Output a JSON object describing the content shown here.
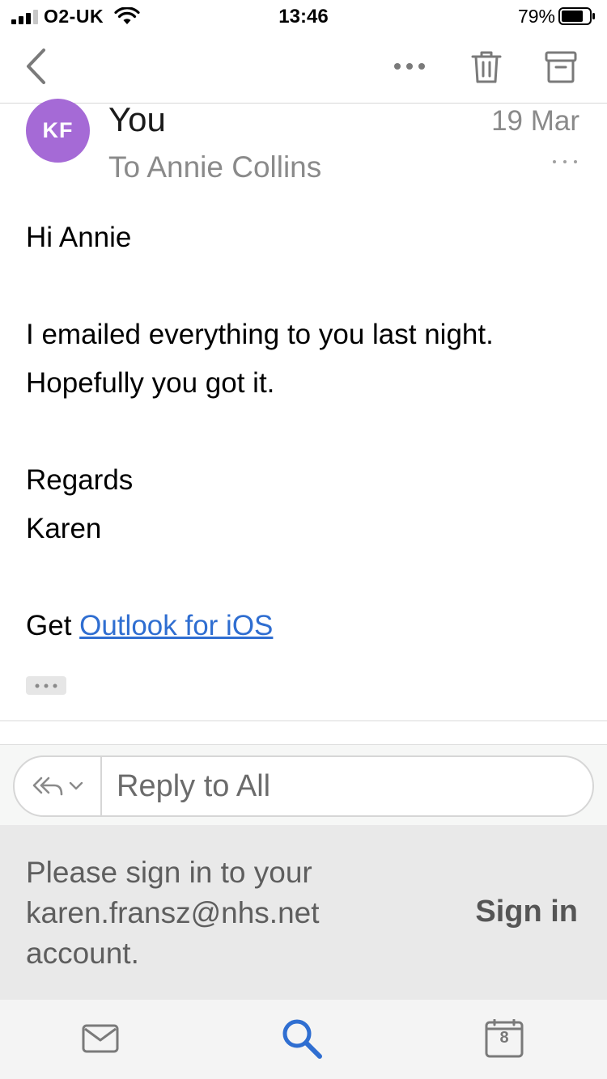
{
  "status_bar": {
    "carrier": "O2-UK",
    "time": "13:46",
    "battery_percent": "79%",
    "battery_level": 0.79,
    "signal_bars": 3,
    "signal_bars_max": 4
  },
  "toolbar": {
    "back_icon": "chevron-left-icon",
    "more_icon": "ellipsis-icon",
    "delete_icon": "trash-icon",
    "archive_icon": "archive-icon"
  },
  "message": {
    "avatar_initials": "KF",
    "avatar_color": "#a56ad6",
    "sender": "You",
    "recipient": "To Annie Collins",
    "date": "19 Mar",
    "body": {
      "greeting": "Hi Annie",
      "line1": "I emailed everything to you last night.",
      "line2": "Hopefully you got it.",
      "closing": "Regards",
      "signature": "Karen",
      "footer_prefix": "Get ",
      "footer_link": "Outlook for iOS"
    },
    "link_color": "#2f6ed1"
  },
  "reply": {
    "placeholder": "Reply to All",
    "type_icon": "reply-all-icon"
  },
  "signin_banner": {
    "message_line1": "Please sign in to your",
    "message_line2": "karen.fransz@nhs.net",
    "message_line3": "account.",
    "button_label": "Sign in"
  },
  "tab_bar": {
    "mail_icon": "mail-icon",
    "search_icon": "search-icon",
    "calendar_icon": "calendar-icon",
    "calendar_day": "8",
    "active_color": "#2f6ed1"
  }
}
